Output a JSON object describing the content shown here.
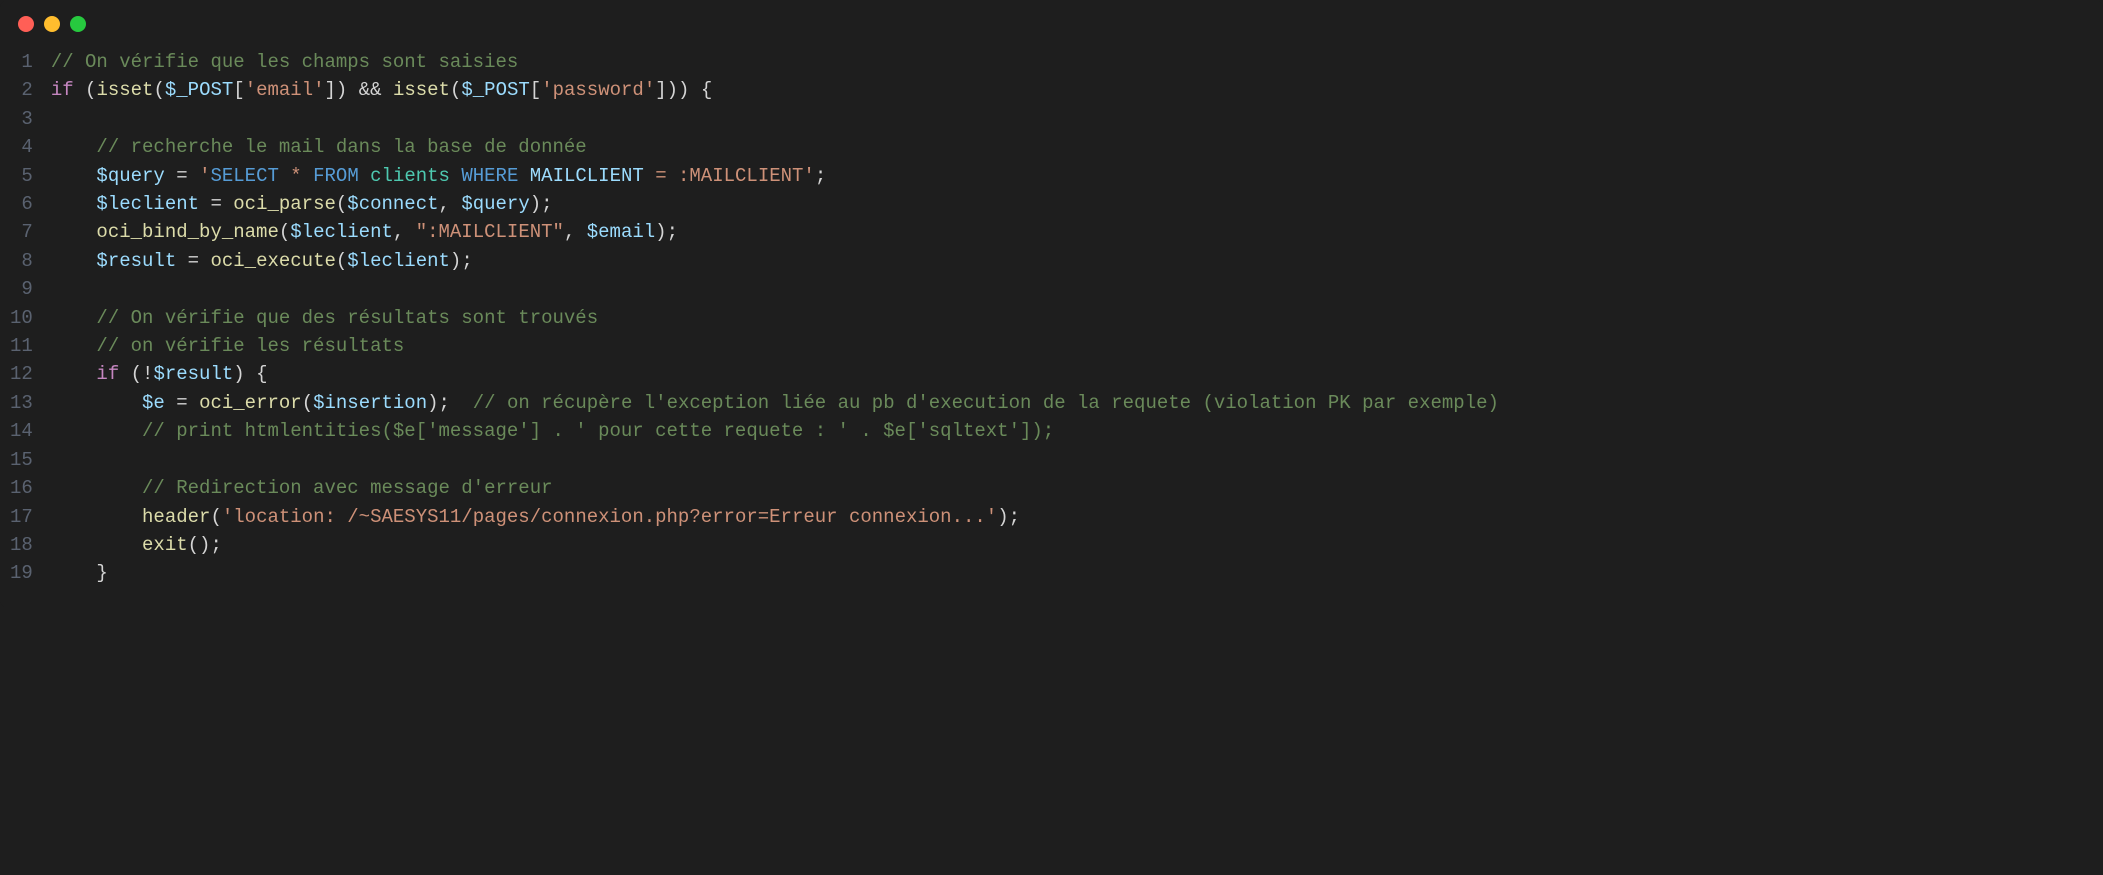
{
  "lineNumbers": [
    "1",
    "2",
    "3",
    "4",
    "5",
    "6",
    "7",
    "8",
    "9",
    "10",
    "11",
    "12",
    "13",
    "14",
    "15",
    "16",
    "17",
    "18",
    "19"
  ],
  "code": {
    "l1_comment": "// On vérifie que les champs sont saisies",
    "l2": {
      "if": "if",
      "isset1": "isset",
      "post1": "$_POST",
      "key1": "'email'",
      "amp": "&&",
      "isset2": "isset",
      "post2": "$_POST",
      "key2": "'password'"
    },
    "l4_comment": "// recherche le mail dans la base de donnée",
    "l5": {
      "var": "$query",
      "eq": " = ",
      "q1": "'",
      "select": "SELECT",
      "star": " * ",
      "from": "FROM",
      "table": " clients ",
      "where": "WHERE",
      "col": " MAILCLIENT ",
      "eq2": "= ",
      "param": ":MAILCLIENT",
      "q2": "'"
    },
    "l6": {
      "var": "$leclient",
      "fn": "oci_parse",
      "a1": "$connect",
      "a2": "$query"
    },
    "l7": {
      "fn": "oci_bind_by_name",
      "a1": "$leclient",
      "a2": "\":MAILCLIENT\"",
      "a3": "$email"
    },
    "l8": {
      "var": "$result",
      "fn": "oci_execute",
      "a1": "$leclient"
    },
    "l10_comment": "// On vérifie que des résultats sont trouvés",
    "l11_comment": "// on vérifie les résultats",
    "l12": {
      "if": "if",
      "not": "!",
      "var": "$result"
    },
    "l13": {
      "var": "$e",
      "fn": "oci_error",
      "a1": "$insertion",
      "cmt": "// on récupère l'exception liée au pb d'execution de la requete (violation PK par exemple)"
    },
    "l14_comment": "// print htmlentities($e['message'] . ' pour cette requete : ' . $e['sqltext']);",
    "l16_comment": "// Redirection avec message d'erreur",
    "l17": {
      "fn": "header",
      "str": "'location: /~SAESYS11/pages/connexion.php?error=Erreur connexion...'"
    },
    "l18": {
      "fn": "exit"
    }
  }
}
